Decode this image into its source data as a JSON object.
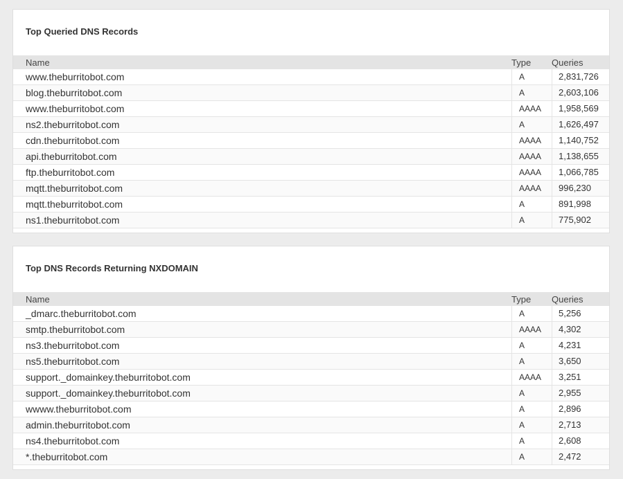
{
  "top_queried": {
    "title": "Top Queried DNS Records",
    "columns": {
      "name": "Name",
      "type": "Type",
      "queries": "Queries"
    },
    "rows": [
      {
        "name": "www.theburritobot.com",
        "type": "A",
        "queries": "2,831,726"
      },
      {
        "name": "blog.theburritobot.com",
        "type": "A",
        "queries": "2,603,106"
      },
      {
        "name": "www.theburritobot.com",
        "type": "AAAA",
        "queries": "1,958,569"
      },
      {
        "name": "ns2.theburritobot.com",
        "type": "A",
        "queries": "1,626,497"
      },
      {
        "name": "cdn.theburritobot.com",
        "type": "AAAA",
        "queries": "1,140,752"
      },
      {
        "name": "api.theburritobot.com",
        "type": "AAAA",
        "queries": "1,138,655"
      },
      {
        "name": "ftp.theburritobot.com",
        "type": "AAAA",
        "queries": "1,066,785"
      },
      {
        "name": "mqtt.theburritobot.com",
        "type": "AAAA",
        "queries": "996,230"
      },
      {
        "name": "mqtt.theburritobot.com",
        "type": "A",
        "queries": "891,998"
      },
      {
        "name": "ns1.theburritobot.com",
        "type": "A",
        "queries": "775,902"
      }
    ]
  },
  "nxdomain": {
    "title": "Top DNS Records Returning NXDOMAIN",
    "columns": {
      "name": "Name",
      "type": "Type",
      "queries": "Queries"
    },
    "rows": [
      {
        "name": "_dmarc.theburritobot.com",
        "type": "A",
        "queries": "5,256"
      },
      {
        "name": "smtp.theburritobot.com",
        "type": "AAAA",
        "queries": "4,302"
      },
      {
        "name": "ns3.theburritobot.com",
        "type": "A",
        "queries": "4,231"
      },
      {
        "name": "ns5.theburritobot.com",
        "type": "A",
        "queries": "3,650"
      },
      {
        "name": "support._domainkey.theburritobot.com",
        "type": "AAAA",
        "queries": "3,251"
      },
      {
        "name": "support._domainkey.theburritobot.com",
        "type": "A",
        "queries": "2,955"
      },
      {
        "name": "wwww.theburritobot.com",
        "type": "A",
        "queries": "2,896"
      },
      {
        "name": "admin.theburritobot.com",
        "type": "A",
        "queries": "2,713"
      },
      {
        "name": "ns4.theburritobot.com",
        "type": "A",
        "queries": "2,608"
      },
      {
        "name": "*.theburritobot.com",
        "type": "A",
        "queries": "2,472"
      }
    ]
  }
}
